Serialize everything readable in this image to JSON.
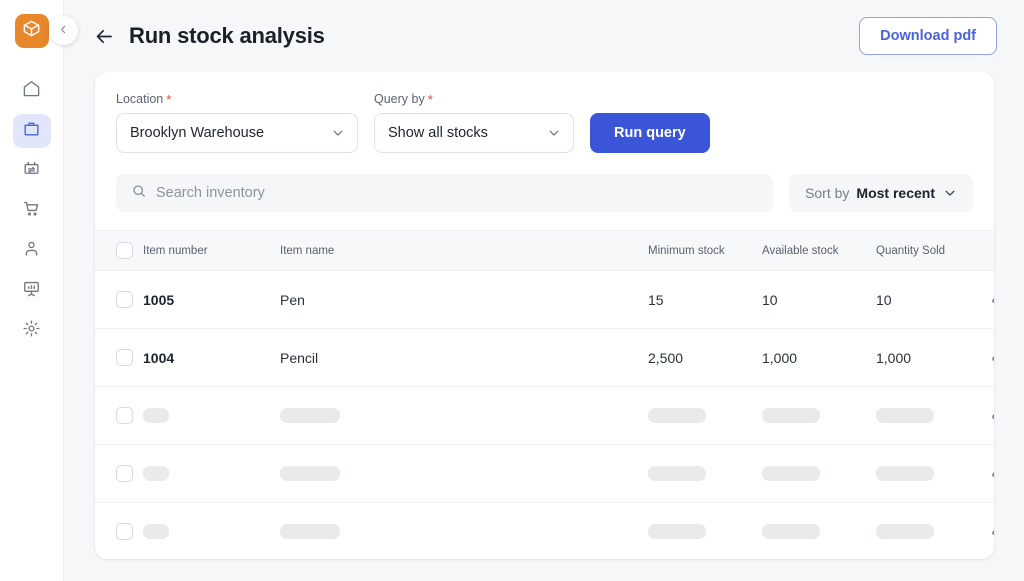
{
  "colors": {
    "brand_orange": "#e8862a",
    "primary_blue": "#3b55d9",
    "accent_blue_text": "#4a63d8",
    "active_nav_bg": "#e2e6fb",
    "page_bg": "#f6f7f9",
    "required_red": "#e8453c",
    "skeleton_gray": "#e8eaec"
  },
  "sidebar": {
    "logo_icon": "cube-box-icon",
    "collapse_icon": "chevron-left-icon",
    "items": [
      {
        "icon": "home-icon",
        "name": "home",
        "active": false
      },
      {
        "icon": "bag-icon",
        "name": "inventory",
        "active": true
      },
      {
        "icon": "transfer-box-icon",
        "name": "transfers",
        "active": false
      },
      {
        "icon": "cart-icon",
        "name": "orders",
        "active": false
      },
      {
        "icon": "user-icon",
        "name": "customers",
        "active": false
      },
      {
        "icon": "presentation-chart-icon",
        "name": "reports",
        "active": false
      },
      {
        "icon": "gear-icon",
        "name": "settings",
        "active": false
      }
    ]
  },
  "header": {
    "back_icon": "arrow-left-icon",
    "title": "Run stock analysis",
    "download_label": "Download pdf"
  },
  "filters": {
    "location": {
      "label": "Location",
      "required_marker": "*",
      "value": "Brooklyn Warehouse",
      "chevron_icon": "chevron-down-icon"
    },
    "query_by": {
      "label": "Query by",
      "required_marker": "*",
      "value": "Show all stocks",
      "chevron_icon": "chevron-down-icon"
    },
    "run_query_label": "Run query"
  },
  "search": {
    "icon": "search-icon",
    "placeholder": "Search inventory"
  },
  "sort": {
    "label": "Sort by",
    "value": "Most recent",
    "chevron_icon": "chevron-down-icon"
  },
  "table": {
    "columns": [
      "Item number",
      "Item name",
      "Minimum stock",
      "Available stock",
      "Quantity Sold"
    ],
    "edit_icon": "pencil-edit-icon",
    "rows": [
      {
        "loaded": true,
        "item_number": "1005",
        "item_name": "Pen",
        "minimum_stock": "15",
        "available_stock": "10",
        "quantity_sold": "10"
      },
      {
        "loaded": true,
        "item_number": "1004",
        "item_name": "Pencil",
        "minimum_stock": "2,500",
        "available_stock": "1,000",
        "quantity_sold": "1,000"
      },
      {
        "loaded": false
      },
      {
        "loaded": false
      },
      {
        "loaded": false
      }
    ]
  }
}
